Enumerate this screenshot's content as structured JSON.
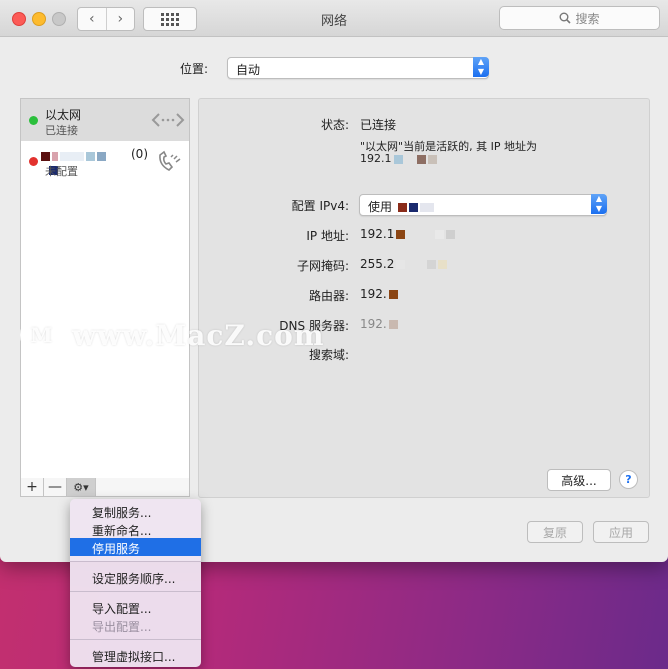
{
  "window": {
    "title": "网络",
    "search_placeholder": "搜索"
  },
  "location": {
    "label": "位置:",
    "value": "自动"
  },
  "services": [
    {
      "name": "以太网",
      "status": "已连接",
      "status_color": "#2bbf3c",
      "selected": true
    },
    {
      "name": "(0)",
      "status": "未配置",
      "status_color": "#e2322e",
      "selected": false
    }
  ],
  "sidebar_tools": {
    "add": "+",
    "remove": "—",
    "gear": "⚙▾"
  },
  "detail": {
    "status_label": "状态:",
    "status_value": "已连接",
    "status_desc_line1": "\"以太网\"当前是活跃的, 其 IP 地址为",
    "status_desc_line2": "192.1",
    "ipv4_label": "配置 IPv4:",
    "ipv4_value": "使用",
    "ip_label": "IP 地址:",
    "ip_value": "192.1",
    "subnet_label": "子网掩码:",
    "subnet_value": "255.2",
    "router_label": "路由器:",
    "router_value": "192.",
    "dns_label": "DNS 服务器:",
    "dns_value": "192.",
    "search_domain_label": "搜索域:",
    "advanced_button": "高级...",
    "help_button": "?"
  },
  "footer": {
    "revert_button": "复原",
    "apply_button": "应用"
  },
  "context_menu": {
    "items": [
      {
        "label": "复制服务...",
        "state": "normal"
      },
      {
        "label": "重新命名...",
        "state": "normal"
      },
      {
        "label": "停用服务",
        "state": "highlighted"
      },
      {
        "label": "设定服务顺序...",
        "state": "normal"
      },
      {
        "label": "导入配置...",
        "state": "normal"
      },
      {
        "label": "导出配置...",
        "state": "disabled"
      },
      {
        "label": "管理虚拟接口...",
        "state": "normal"
      }
    ]
  },
  "watermark": {
    "text": "www.MacZ.com"
  },
  "colors": {
    "accent": "#1f6fe6",
    "window_bg": "#ececec",
    "connected": "#2bbf3c",
    "disconnected": "#e2322e"
  }
}
